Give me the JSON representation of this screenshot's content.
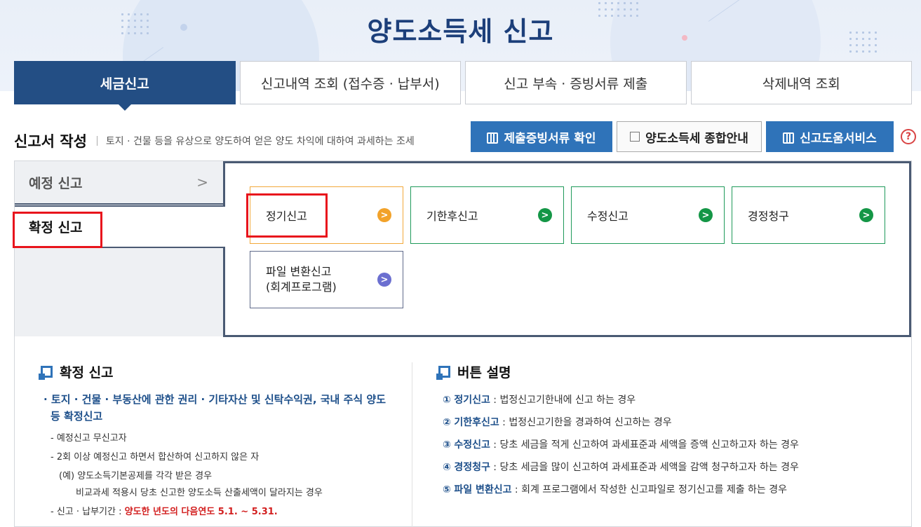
{
  "page": {
    "title": "양도소득세 신고"
  },
  "tabs": [
    {
      "label": "세금신고"
    },
    {
      "label": "신고내역 조회 (접수증 · 납부서)"
    },
    {
      "label": "신고 부속 · 증빙서류 제출"
    },
    {
      "label": "삭제내역 조회"
    }
  ],
  "section": {
    "title": "신고서 작성",
    "desc": "토지 · 건물 등을 유상으로 양도하여 얻은 양도 차익에 대하여 과세하는 조세"
  },
  "top_buttons": {
    "evidence": "제출증빙서류 확인",
    "guide": "양도소득세 종합안내",
    "help_service": "신고도움서비스",
    "help_mark": "?"
  },
  "left_nav": {
    "preliminary": "예정 신고",
    "preliminary_chevron": ">",
    "final": "확정 신고"
  },
  "cards": {
    "regular": "정기신고",
    "late": "기한후신고",
    "amended": "수정신고",
    "claim": "경정청구",
    "file_line1": "파일 변환신고",
    "file_line2": "(회계프로그램)",
    "arrow": ">"
  },
  "info_left": {
    "title": "확정 신고",
    "bullet_line1": "· 토지 · 건물 · 부동산에 관한 권리 · 기타자산 및 신탁수익권, 국내 주식 양도",
    "bullet_line2": "등 확정신고",
    "item1": "- 예정신고 무신고자",
    "item2": "- 2회 이상 예정신고 하면서 합산하여 신고하지 않은 자",
    "item3": "(예) 양도소득기본공제를 각각 받은 경우",
    "item4": "비교과세 적용시 당초 신고한 양도소득 산출세액이 달라지는 경우",
    "period_label": "- 신고 · 납부기간 : ",
    "period_value": "양도한 년도의 다음연도 5.1. ~ 5.31."
  },
  "info_right": {
    "title": "버튼 설명",
    "rows": [
      {
        "num": "①",
        "name": "정기신고",
        "desc": " : 법정신고기한내에 신고 하는 경우"
      },
      {
        "num": "②",
        "name": "기한후신고",
        "desc": " : 법정신고기한을 경과하여 신고하는 경우"
      },
      {
        "num": "③",
        "name": "수정신고",
        "desc": " : 당초 세금을 적게 신고하여 과세표준과 세액을 증액 신고하고자 하는 경우"
      },
      {
        "num": "④",
        "name": "경정청구",
        "desc": " : 당초 세금을 많이 신고하여 과세표준과 세액을 감액 청구하고자 하는 경우"
      },
      {
        "num": "⑤",
        "name": "파일 변환신고",
        "desc": " : 회계 프로그램에서 작성한 신고파일로 정기신고를  제출 하는 경우"
      }
    ]
  },
  "colors": {
    "primary": "#234e84",
    "button_blue": "#2f73b9",
    "highlight_red": "#e8141c",
    "arrow_orange": "#f2a22a",
    "arrow_green": "#149646",
    "arrow_purple": "#6b6fd0"
  }
}
